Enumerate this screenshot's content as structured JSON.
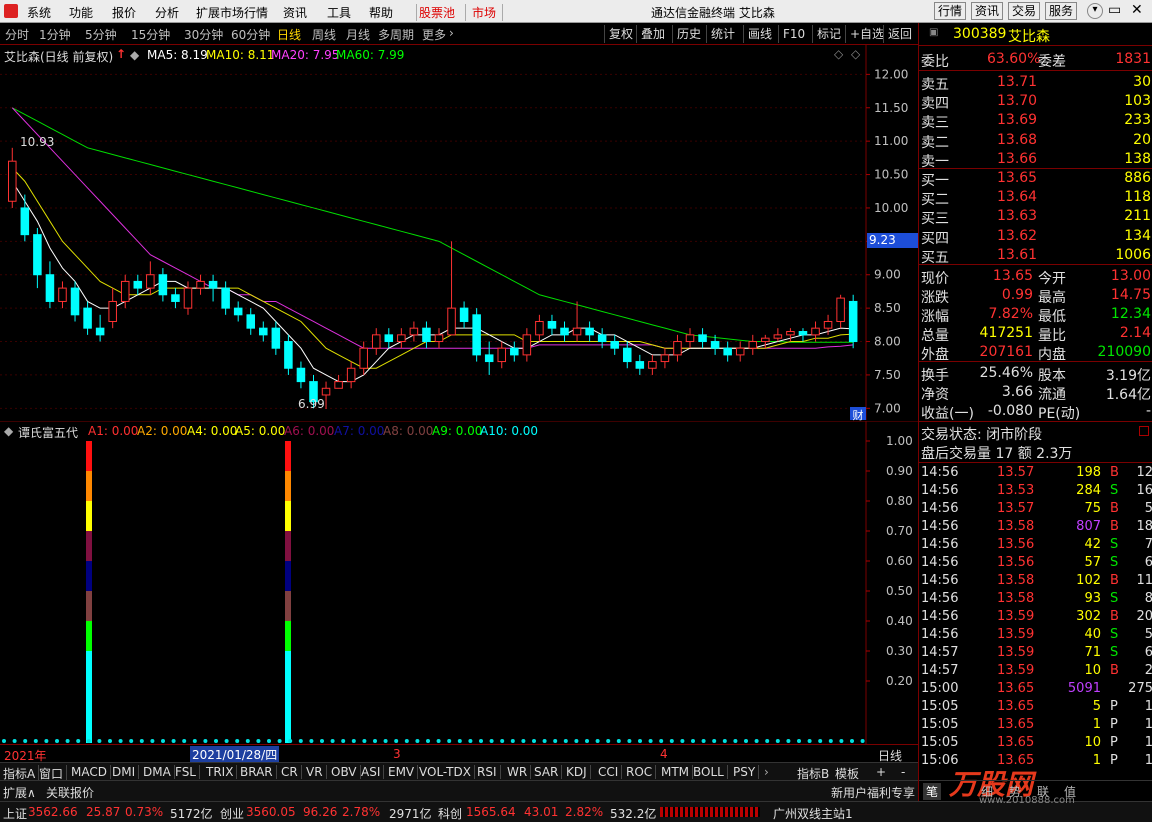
{
  "menubar": {
    "items": [
      "系统",
      "功能",
      "报价",
      "分析",
      "扩展市场行情",
      "资讯",
      "工具",
      "帮助"
    ],
    "stockpool": "股票池",
    "market": "市场",
    "title": "通达信金融终端  艾比森",
    "right_buttons": [
      "行情",
      "资讯",
      "交易",
      "服务"
    ]
  },
  "periods": [
    "分时",
    "1分钟",
    "5分钟",
    "15分钟",
    "30分钟",
    "60分钟",
    "日线",
    "周线",
    "月线",
    "多周期",
    "更多"
  ],
  "active_period": "日线",
  "tools": [
    "复权",
    "叠加",
    "历史",
    "统计",
    "画线",
    "F10",
    "标记",
    "+自选",
    "返回"
  ],
  "chart": {
    "title": "艾比森(日线 前复权)",
    "ma5": "MA5: 8.19",
    "ma10": "MA10: 8.11",
    "ma20": "MA20: 7.95",
    "ma60": "MA60: 7.99",
    "price_ticks": [
      "12.00",
      "11.50",
      "11.00",
      "10.50",
      "10.00",
      "9.50",
      "9.00",
      "8.50",
      "8.00",
      "7.50",
      "7.00"
    ],
    "current_price_tag": "9.23",
    "high_marker": "10.93",
    "low_marker": "6.99",
    "badge": "财"
  },
  "chart_data": {
    "type": "candlestick",
    "ylim": [
      6.9,
      12.2
    ],
    "candles": [
      [
        10.1,
        10.7,
        10.9,
        10.0
      ],
      [
        10.0,
        9.6,
        10.2,
        9.5
      ],
      [
        9.6,
        9.0,
        9.7,
        8.8
      ],
      [
        9.0,
        8.6,
        9.2,
        8.5
      ],
      [
        8.6,
        8.8,
        8.9,
        8.5
      ],
      [
        8.8,
        8.4,
        8.9,
        8.3
      ],
      [
        8.5,
        8.2,
        8.6,
        8.1
      ],
      [
        8.2,
        8.1,
        8.4,
        8.0
      ],
      [
        8.3,
        8.6,
        8.8,
        8.2
      ],
      [
        8.6,
        8.9,
        9.0,
        8.5
      ],
      [
        8.9,
        8.8,
        9.0,
        8.7
      ],
      [
        8.8,
        9.0,
        9.2,
        8.7
      ],
      [
        9.0,
        8.7,
        9.1,
        8.6
      ],
      [
        8.7,
        8.6,
        8.8,
        8.5
      ],
      [
        8.5,
        8.8,
        8.9,
        8.4
      ],
      [
        8.8,
        8.9,
        9.0,
        8.7
      ],
      [
        8.9,
        8.8,
        9.0,
        8.6
      ],
      [
        8.8,
        8.5,
        8.9,
        8.4
      ],
      [
        8.5,
        8.4,
        8.6,
        8.3
      ],
      [
        8.4,
        8.2,
        8.5,
        8.1
      ],
      [
        8.2,
        8.1,
        8.3,
        8.0
      ],
      [
        8.2,
        7.9,
        8.3,
        7.8
      ],
      [
        8.0,
        7.6,
        8.1,
        7.5
      ],
      [
        7.6,
        7.4,
        7.7,
        7.3
      ],
      [
        7.4,
        7.1,
        7.5,
        7.0
      ],
      [
        7.2,
        7.3,
        7.4,
        6.99
      ],
      [
        7.3,
        7.4,
        7.5,
        7.3
      ],
      [
        7.4,
        7.6,
        7.7,
        7.3
      ],
      [
        7.6,
        7.9,
        8.0,
        7.5
      ],
      [
        7.9,
        8.1,
        8.2,
        7.8
      ],
      [
        8.1,
        8.0,
        8.2,
        7.9
      ],
      [
        8.0,
        8.1,
        8.2,
        7.9
      ],
      [
        8.1,
        8.2,
        8.3,
        8.0
      ],
      [
        8.2,
        8.0,
        8.3,
        7.9
      ],
      [
        8.0,
        8.1,
        8.2,
        7.9
      ],
      [
        8.1,
        8.5,
        9.5,
        8.1
      ],
      [
        8.5,
        8.3,
        8.6,
        8.2
      ],
      [
        8.4,
        7.8,
        8.5,
        7.7
      ],
      [
        7.8,
        7.7,
        8.0,
        7.5
      ],
      [
        7.7,
        7.9,
        8.0,
        7.6
      ],
      [
        7.9,
        7.8,
        8.0,
        7.7
      ],
      [
        7.8,
        8.1,
        8.2,
        7.7
      ],
      [
        8.1,
        8.3,
        8.4,
        8.0
      ],
      [
        8.3,
        8.2,
        8.4,
        8.1
      ],
      [
        8.2,
        8.1,
        8.3,
        8.0
      ],
      [
        8.1,
        8.2,
        8.6,
        8.0
      ],
      [
        8.2,
        8.1,
        8.3,
        8.0
      ],
      [
        8.1,
        8.0,
        8.2,
        7.9
      ],
      [
        8.0,
        7.9,
        8.1,
        7.8
      ],
      [
        7.9,
        7.7,
        8.0,
        7.6
      ],
      [
        7.7,
        7.6,
        7.8,
        7.5
      ],
      [
        7.6,
        7.7,
        7.8,
        7.5
      ],
      [
        7.7,
        7.8,
        7.9,
        7.6
      ],
      [
        7.8,
        8.0,
        8.1,
        7.7
      ],
      [
        8.0,
        8.1,
        8.2,
        7.9
      ],
      [
        8.1,
        8.0,
        8.2,
        7.9
      ],
      [
        8.0,
        7.9,
        8.1,
        7.8
      ],
      [
        7.9,
        7.8,
        8.0,
        7.7
      ],
      [
        7.8,
        7.9,
        8.0,
        7.7
      ],
      [
        7.9,
        8.0,
        8.1,
        7.8
      ],
      [
        8.0,
        8.05,
        8.1,
        7.9
      ],
      [
        8.05,
        8.1,
        8.2,
        8.0
      ],
      [
        8.1,
        8.15,
        8.2,
        8.0
      ],
      [
        8.15,
        8.1,
        8.2,
        8.0
      ],
      [
        8.1,
        8.2,
        8.3,
        8.0
      ],
      [
        8.2,
        8.3,
        8.4,
        8.1
      ],
      [
        8.3,
        8.65,
        8.7,
        8.2
      ],
      [
        8.6,
        8.0,
        8.7,
        7.9
      ]
    ],
    "ma5": [
      10.4,
      10.1,
      9.8,
      9.4,
      9.1,
      8.9,
      8.6,
      8.5,
      8.5,
      8.6,
      8.7,
      8.8,
      8.9,
      8.9,
      8.8,
      8.8,
      8.8,
      8.8,
      8.7,
      8.6,
      8.5,
      8.3,
      8.1,
      7.9,
      7.6,
      7.5,
      7.4,
      7.4,
      7.5,
      7.7,
      7.9,
      8.0,
      8.1,
      8.1,
      8.1,
      8.2,
      8.2,
      8.2,
      8.1,
      8.0,
      7.9,
      7.9,
      8.0,
      8.1,
      8.1,
      8.2,
      8.2,
      8.1,
      8.1,
      8.0,
      7.9,
      7.8,
      7.8,
      7.8,
      7.9,
      7.9,
      7.9,
      7.9,
      7.9,
      7.9,
      7.95,
      8.0,
      8.05,
      8.1,
      8.1,
      8.15,
      8.2,
      8.19
    ],
    "ma10": [
      10.6,
      10.4,
      10.1,
      9.8,
      9.5,
      9.3,
      9.1,
      8.9,
      8.8,
      8.7,
      8.7,
      8.7,
      8.8,
      8.8,
      8.8,
      8.8,
      8.8,
      8.8,
      8.8,
      8.7,
      8.6,
      8.5,
      8.4,
      8.3,
      8.1,
      7.9,
      7.8,
      7.7,
      7.6,
      7.6,
      7.7,
      7.8,
      7.9,
      8.0,
      8.0,
      8.1,
      8.1,
      8.1,
      8.1,
      8.1,
      8.1,
      8.0,
      8.0,
      8.0,
      8.0,
      8.0,
      8.0,
      8.0,
      8.0,
      8.0,
      8.0,
      7.95,
      7.9,
      7.9,
      7.9,
      7.9,
      7.9,
      7.9,
      7.9,
      7.9,
      7.9,
      7.95,
      8.0,
      8.0,
      8.05,
      8.05,
      8.1,
      8.11
    ],
    "ma20": [
      11.5,
      11.3,
      11.1,
      10.9,
      10.7,
      10.5,
      10.3,
      10.1,
      9.9,
      9.7,
      9.5,
      9.3,
      9.2,
      9.1,
      9.0,
      8.9,
      8.8,
      8.8,
      8.7,
      8.7,
      8.6,
      8.6,
      8.5,
      8.4,
      8.3,
      8.2,
      8.1,
      8.0,
      7.9,
      7.9,
      7.9,
      7.9,
      7.9,
      7.9,
      7.9,
      7.9,
      7.9,
      7.9,
      7.9,
      7.9,
      7.9,
      7.9,
      7.95,
      7.95,
      7.95,
      7.95,
      7.95,
      7.95,
      7.95,
      7.95,
      7.95,
      7.95,
      7.9,
      7.9,
      7.9,
      7.9,
      7.9,
      7.9,
      7.9,
      7.9,
      7.9,
      7.9,
      7.9,
      7.9,
      7.9,
      7.92,
      7.93,
      7.95
    ],
    "ma60": [
      11.5,
      11.4,
      11.3,
      11.2,
      11.1,
      11.0,
      10.9,
      10.85,
      10.8,
      10.75,
      10.7,
      10.65,
      10.6,
      10.55,
      10.5,
      10.45,
      10.4,
      10.35,
      10.3,
      10.25,
      10.2,
      10.15,
      10.1,
      10.05,
      10.0,
      9.95,
      9.9,
      9.85,
      9.8,
      9.75,
      9.7,
      9.65,
      9.6,
      9.55,
      9.5,
      9.4,
      9.3,
      9.2,
      9.1,
      9.0,
      8.9,
      8.8,
      8.7,
      8.65,
      8.6,
      8.55,
      8.5,
      8.45,
      8.4,
      8.35,
      8.3,
      8.25,
      8.2,
      8.15,
      8.1,
      8.08,
      8.06,
      8.04,
      8.02,
      8.0,
      8.0,
      8.0,
      7.99,
      7.99,
      7.99,
      7.99,
      7.99,
      7.99
    ]
  },
  "indicator": {
    "name": "谭氏富五代",
    "labels": [
      "A1: 0.00",
      "A2: 0.00",
      "A4: 0.00",
      "A5: 0.00",
      "A6: 0.00",
      "A7: 0.00",
      "A8: 0.00",
      "A9: 0.00",
      "A10: 0.00"
    ],
    "label_colors": [
      "#ff3030",
      "#ffaa00",
      "#ffff00",
      "#ffff00",
      "#a01050",
      "#0000a0",
      "#804040",
      "#00ff00",
      "#00ffff"
    ],
    "ticks": [
      "1.00",
      "0.90",
      "0.80",
      "0.70",
      "0.60",
      "0.50",
      "0.40",
      "0.30",
      "0.20"
    ],
    "bar_colors": [
      "#ff1010",
      "#ff8800",
      "#ffff00",
      "#801040",
      "#000080",
      "#804040",
      "#00ff00",
      "#00ffff"
    ]
  },
  "dates": {
    "y2021": "2021年",
    "sel": "2021/01/28/四",
    "m3": "3",
    "m4": "4",
    "period_label": "日线"
  },
  "tabs": [
    "指标A",
    "窗口",
    "MACD",
    "DMI",
    "DMA",
    "FSL",
    "TRIX",
    "BRAR",
    "CR",
    "VR",
    "OBV",
    "ASI",
    "EMV",
    "VOL-TDX",
    "RSI",
    "WR",
    "SAR",
    "KDJ",
    "CCI",
    "ROC",
    "MTM",
    "BOLL",
    "PSY"
  ],
  "tabs_right": [
    "指标B",
    "模板",
    "+",
    "-"
  ],
  "bottom": {
    "ext": "扩展∧",
    "related": "关联报价",
    "promo": "新用户福利专享",
    "bi": "笔"
  },
  "status": {
    "sh_name": "上证",
    "sh_val": "3562.66",
    "sh_chg": "25.87",
    "sh_pct": "0.73%",
    "sh_amt": "5172亿",
    "cy_name": "创业",
    "cy_val": "3560.05",
    "cy_chg": "96.26",
    "cy_pct": "2.78%",
    "cy_amt": "2971亿",
    "kc_name": "科创",
    "kc_val": "1565.64",
    "kc_chg": "43.01",
    "kc_pct": "2.82%",
    "kc_amt": "532.2亿",
    "server": "广州双线主站1"
  },
  "quote": {
    "code": "300389",
    "name": "艾比森",
    "webi_label": "委比",
    "webi": "63.60%",
    "weicha_label": "委差",
    "weicha": "1831",
    "asks": [
      [
        "卖五",
        "13.71",
        "30"
      ],
      [
        "卖四",
        "13.70",
        "103"
      ],
      [
        "卖三",
        "13.69",
        "233"
      ],
      [
        "卖二",
        "13.68",
        "20"
      ],
      [
        "卖一",
        "13.66",
        "138"
      ]
    ],
    "bids": [
      [
        "买一",
        "13.65",
        "886"
      ],
      [
        "买二",
        "13.64",
        "118"
      ],
      [
        "买三",
        "13.63",
        "211"
      ],
      [
        "买四",
        "13.62",
        "134"
      ],
      [
        "买五",
        "13.61",
        "1006"
      ]
    ],
    "stats": [
      [
        "现价",
        "13.65",
        "今开",
        "13.00"
      ],
      [
        "涨跌",
        "0.99",
        "最高",
        "14.75"
      ],
      [
        "涨幅",
        "7.82%",
        "最低",
        "12.34"
      ],
      [
        "总量",
        "417251",
        "量比",
        "2.14"
      ],
      [
        "外盘",
        "207161",
        "内盘",
        "210090"
      ]
    ],
    "stats2": [
      [
        "换手",
        "25.46%",
        "股本",
        "3.19亿"
      ],
      [
        "净资",
        "3.66",
        "流通",
        "1.64亿"
      ],
      [
        "收益(一)",
        "-0.080",
        "PE(动)",
        "-"
      ]
    ],
    "trade_status": "交易状态: 闭市阶段",
    "after_hours": "盘后交易量 17 额 2.3万",
    "ticks": [
      [
        "14:56",
        "13.57",
        "198",
        "B",
        "12"
      ],
      [
        "14:56",
        "13.53",
        "284",
        "S",
        "16"
      ],
      [
        "14:56",
        "13.57",
        "75",
        "B",
        "5"
      ],
      [
        "14:56",
        "13.58",
        "807",
        "B",
        "18"
      ],
      [
        "14:56",
        "13.56",
        "42",
        "S",
        "7"
      ],
      [
        "14:56",
        "13.56",
        "57",
        "S",
        "6"
      ],
      [
        "14:56",
        "13.58",
        "102",
        "B",
        "11"
      ],
      [
        "14:56",
        "13.58",
        "93",
        "S",
        "8"
      ],
      [
        "14:56",
        "13.59",
        "302",
        "B",
        "20"
      ],
      [
        "14:56",
        "13.59",
        "40",
        "S",
        "5"
      ],
      [
        "14:57",
        "13.59",
        "71",
        "S",
        "6"
      ],
      [
        "14:57",
        "13.59",
        "10",
        "B",
        "2"
      ],
      [
        "15:00",
        "13.65",
        "5091",
        "",
        "275"
      ],
      [
        "15:05",
        "13.65",
        "5",
        "P",
        "1"
      ],
      [
        "15:05",
        "13.65",
        "1",
        "P",
        "1"
      ],
      [
        "15:05",
        "13.65",
        "10",
        "P",
        "1"
      ],
      [
        "15:06",
        "13.65",
        "1",
        "P",
        "1"
      ]
    ],
    "bottom_tabs": [
      "笔",
      "细",
      "势",
      "联",
      "值"
    ],
    "watermark": "万股网",
    "watermark_url": "www.2010888.com"
  }
}
